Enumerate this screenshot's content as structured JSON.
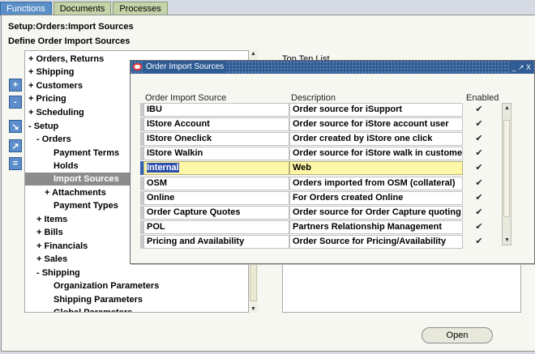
{
  "tabs": [
    "Functions",
    "Documents",
    "Processes"
  ],
  "breadcrumb": "Setup:Orders:Import Sources",
  "page_title": "Define Order Import Sources",
  "side_buttons": [
    "+",
    "-",
    "↘",
    "↗",
    "="
  ],
  "tree": [
    {
      "label": "+ Orders, Returns",
      "selected": false
    },
    {
      "label": "+ Shipping",
      "selected": false
    },
    {
      "label": "+ Customers",
      "selected": false
    },
    {
      "label": "+ Pricing",
      "selected": false
    },
    {
      "label": "+ Scheduling",
      "selected": false
    },
    {
      "label": "- Setup",
      "selected": false
    },
    {
      "label": "- Orders",
      "selected": false
    },
    {
      "label": "Payment Terms",
      "selected": false
    },
    {
      "label": "Holds",
      "selected": false
    },
    {
      "label": "Import Sources",
      "selected": true
    },
    {
      "label": "+ Attachments",
      "selected": false
    },
    {
      "label": "Payment Types",
      "selected": false
    },
    {
      "label": "+ Items",
      "selected": false
    },
    {
      "label": "+ Bills",
      "selected": false
    },
    {
      "label": "+ Financials",
      "selected": false
    },
    {
      "label": "+ Sales",
      "selected": false
    },
    {
      "label": "- Shipping",
      "selected": false
    },
    {
      "label": "Organization Parameters",
      "selected": false
    },
    {
      "label": "Shipping Parameters",
      "selected": false
    },
    {
      "label": "Global Parameters",
      "selected": false
    }
  ],
  "top_ten_label": "Top Ten List",
  "open_button": "Open",
  "dialog": {
    "title": "Order Import Sources",
    "controls": "_ ↗ X",
    "headers": {
      "source": "Order Import Source",
      "description": "Description",
      "enabled": "Enabled"
    },
    "rows": [
      {
        "source": "IBU",
        "description": "Order source for iSupport",
        "enabled": true,
        "current": false
      },
      {
        "source": "IStore Account",
        "description": "Order source for iStore account user",
        "enabled": true,
        "current": false
      },
      {
        "source": "IStore Oneclick",
        "description": "Order created by iStore one click",
        "enabled": true,
        "current": false
      },
      {
        "source": "IStore Walkin",
        "description": "Order source for iStore walk in customer",
        "enabled": true,
        "current": false
      },
      {
        "source": "Internal",
        "description": "Web",
        "enabled": true,
        "current": true
      },
      {
        "source": "OSM",
        "description": "Orders imported from OSM (collateral)",
        "enabled": true,
        "current": false
      },
      {
        "source": "Online",
        "description": "For Orders created Online",
        "enabled": true,
        "current": false
      },
      {
        "source": "Order Capture Quotes",
        "description": "Order source for Order Capture quoting mod",
        "enabled": true,
        "current": false
      },
      {
        "source": "POL",
        "description": "Partners Relationship Management",
        "enabled": true,
        "current": false
      },
      {
        "source": "Pricing and Availability",
        "description": "Order Source for Pricing/Availability",
        "enabled": true,
        "current": false
      }
    ],
    "check_glyph": "✔"
  }
}
